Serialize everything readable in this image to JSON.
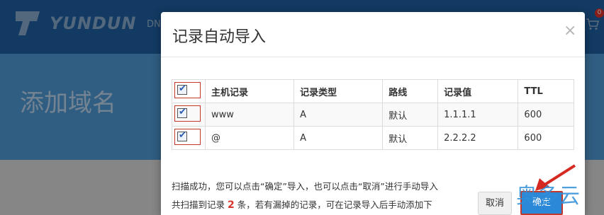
{
  "background": {
    "logo_text": "YUNDUN",
    "nav_text": "DN",
    "cart_badge": "0",
    "page_title": "添加域名"
  },
  "modal": {
    "title": "记录自动导入",
    "close_symbol": "×",
    "table": {
      "headers": [
        "主机记录",
        "记录类型",
        "路线",
        "记录值",
        "TTL"
      ],
      "rows": [
        {
          "checked": true,
          "host": "www",
          "type": "A",
          "line": "默认",
          "value": "1.1.1.1",
          "ttl": "600"
        },
        {
          "checked": true,
          "host": "@",
          "type": "A",
          "line": "默认",
          "value": "2.2.2.2",
          "ttl": "600"
        }
      ]
    },
    "message_line1": "扫描成功，您可以点击“确定”导入，也可以点击“取消”进行手动导入",
    "message_line2_prefix": "共扫描到记录",
    "message_line2_count": "2",
    "message_line2_suffix": "条，若有漏掉的记录，可在记录导入后手动添加下",
    "cancel_label": "取消",
    "ok_label": "确定"
  },
  "watermark_text": "奥多云",
  "colors": {
    "header_bg": "#1d5e9e",
    "primary_button": "#2b87d8",
    "highlight_border": "#c0392b",
    "count_red": "#d9342b"
  }
}
